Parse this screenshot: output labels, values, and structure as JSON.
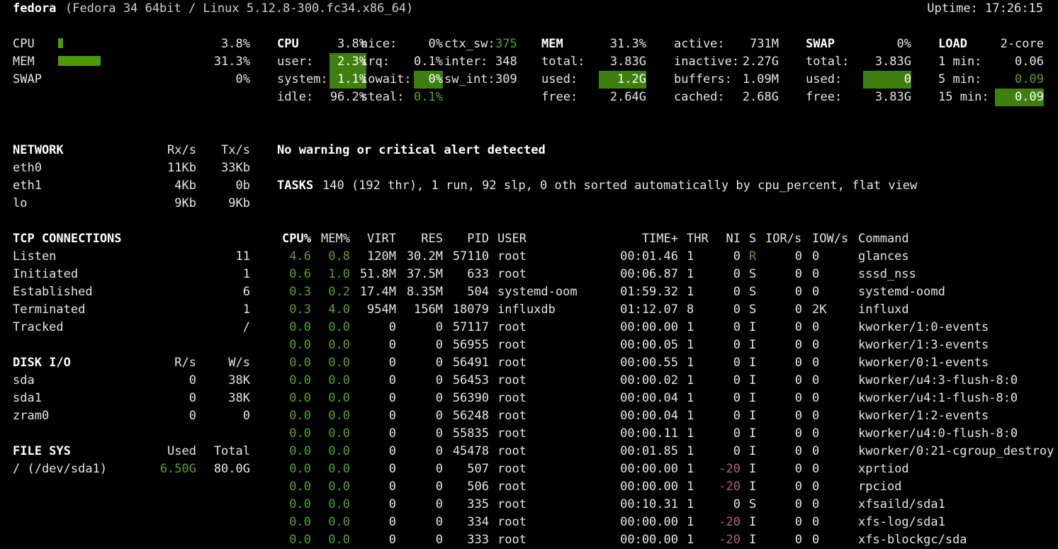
{
  "header": {
    "hostname": "fedora",
    "sysinfo": "(Fedora 34 64bit / Linux 5.12.8-300.fc34.x86_64)",
    "uptime": "Uptime: 17:26:15"
  },
  "quicklook": {
    "cpu": {
      "label": "CPU",
      "value": "3.8%",
      "pct": 3.8
    },
    "mem": {
      "label": "MEM",
      "value": "31.3%",
      "pct": 31.3
    },
    "swap": {
      "label": "SWAP",
      "value": "0%",
      "pct": 0
    }
  },
  "cpu": {
    "title": "CPU",
    "total": "3.8%",
    "user_label": "user:",
    "user": "2.3%",
    "system_label": "system:",
    "system": "1.1%",
    "idle_label": "idle:",
    "idle": "96.2%",
    "nice_label": "nice:",
    "nice": "0%",
    "irq_label": "irq:",
    "irq": "0.1%",
    "iowait_label": "iowait:",
    "iowait": "0%",
    "steal_label": "steal:",
    "steal": "0.1%",
    "ctx_sw_label": "ctx_sw:",
    "ctx_sw": "375",
    "inter_label": "inter:",
    "inter": "348",
    "sw_int_label": "sw_int:",
    "sw_int": "309"
  },
  "mem": {
    "title": "MEM",
    "pct": "31.3%",
    "total_label": "total:",
    "total": "3.83G",
    "used_label": "used:",
    "used": "1.2G",
    "free_label": "free:",
    "free": "2.64G",
    "active_label": "active:",
    "active": "731M",
    "inactive_label": "inactive:",
    "inactive": "2.27G",
    "buffers_label": "buffers:",
    "buffers": "1.09M",
    "cached_label": "cached:",
    "cached": "2.68G"
  },
  "swap": {
    "title": "SWAP",
    "pct": "0%",
    "total_label": "total:",
    "total": "3.83G",
    "used_label": "used:",
    "used": "0",
    "free_label": "free:",
    "free": "3.83G"
  },
  "load": {
    "title": "LOAD",
    "cores": "2-core",
    "min1_label": "1 min:",
    "min1": "0.06",
    "min5_label": "5 min:",
    "min5": "0.09",
    "min15_label": "15 min:",
    "min15": "0.09"
  },
  "network": {
    "title": "NETWORK",
    "rx_label": "Rx/s",
    "tx_label": "Tx/s",
    "rows": [
      {
        "name": "eth0",
        "rx": "11Kb",
        "tx": "33Kb"
      },
      {
        "name": "eth1",
        "rx": "4Kb",
        "tx": "0b"
      },
      {
        "name": "lo",
        "rx": "9Kb",
        "tx": "9Kb"
      }
    ]
  },
  "tcp": {
    "title": "TCP CONNECTIONS",
    "rows": [
      {
        "name": "Listen",
        "value": "11"
      },
      {
        "name": "Initiated",
        "value": "1"
      },
      {
        "name": "Established",
        "value": "6"
      },
      {
        "name": "Terminated",
        "value": "1"
      },
      {
        "name": "Tracked",
        "value": "/"
      }
    ]
  },
  "disk": {
    "title": "DISK I/O",
    "r_label": "R/s",
    "w_label": "W/s",
    "rows": [
      {
        "name": "sda",
        "r": "0",
        "w": "38K"
      },
      {
        "name": "sda1",
        "r": "0",
        "w": "38K"
      },
      {
        "name": "zram0",
        "r": "0",
        "w": "0"
      }
    ]
  },
  "fs": {
    "title": "FILE SYS",
    "used_label": "Used",
    "total_label": "Total",
    "rows": [
      {
        "name": "/ (/dev/sda1)",
        "used": "6.50G",
        "total": "80.0G"
      }
    ]
  },
  "alert": "No warning or critical alert detected",
  "tasks": {
    "label": "TASKS",
    "text": "140 (192 thr), 1 run, 92 slp, 0 oth sorted automatically by cpu_percent, flat view"
  },
  "proc_headers": {
    "cpu": "CPU%",
    "mem": "MEM%",
    "virt": "VIRT",
    "res": "RES",
    "pid": "PID",
    "user": "USER",
    "time": "TIME+",
    "thr": "THR",
    "ni": "NI",
    "s": "S",
    "ior": "IOR/s",
    "iow": "IOW/s",
    "cmd": "Command"
  },
  "processes": [
    {
      "cpu": "4.6",
      "mem": "0.8",
      "virt": "120M",
      "res": "30.2M",
      "pid": "57110",
      "user": "root",
      "time": "00:01.46",
      "thr": "1",
      "ni": "0",
      "s": "R",
      "ior": "0",
      "iow": "0",
      "cmd": "glances"
    },
    {
      "cpu": "0.6",
      "mem": "1.0",
      "virt": "51.8M",
      "res": "37.5M",
      "pid": "633",
      "user": "root",
      "time": "00:06.87",
      "thr": "1",
      "ni": "0",
      "s": "S",
      "ior": "0",
      "iow": "0",
      "cmd": "sssd_nss"
    },
    {
      "cpu": "0.3",
      "mem": "0.2",
      "virt": "17.4M",
      "res": "8.35M",
      "pid": "504",
      "user": "systemd-oom",
      "time": "01:59.32",
      "thr": "1",
      "ni": "0",
      "s": "S",
      "ior": "0",
      "iow": "0",
      "cmd": "systemd-oomd"
    },
    {
      "cpu": "0.3",
      "mem": "4.0",
      "virt": "954M",
      "res": "156M",
      "pid": "18079",
      "user": "influxdb",
      "time": "01:12.07",
      "thr": "8",
      "ni": "0",
      "s": "S",
      "ior": "0",
      "iow": "2K",
      "cmd": "influxd"
    },
    {
      "cpu": "0.0",
      "mem": "0.0",
      "virt": "0",
      "res": "0",
      "pid": "57117",
      "user": "root",
      "time": "00:00.00",
      "thr": "1",
      "ni": "0",
      "s": "I",
      "ior": "0",
      "iow": "0",
      "cmd": "kworker/1:0-events"
    },
    {
      "cpu": "0.0",
      "mem": "0.0",
      "virt": "0",
      "res": "0",
      "pid": "56955",
      "user": "root",
      "time": "00:00.05",
      "thr": "1",
      "ni": "0",
      "s": "I",
      "ior": "0",
      "iow": "0",
      "cmd": "kworker/1:3-events"
    },
    {
      "cpu": "0.0",
      "mem": "0.0",
      "virt": "0",
      "res": "0",
      "pid": "56491",
      "user": "root",
      "time": "00:00.55",
      "thr": "1",
      "ni": "0",
      "s": "I",
      "ior": "0",
      "iow": "0",
      "cmd": "kworker/0:1-events"
    },
    {
      "cpu": "0.0",
      "mem": "0.0",
      "virt": "0",
      "res": "0",
      "pid": "56453",
      "user": "root",
      "time": "00:00.02",
      "thr": "1",
      "ni": "0",
      "s": "I",
      "ior": "0",
      "iow": "0",
      "cmd": "kworker/u4:3-flush-8:0"
    },
    {
      "cpu": "0.0",
      "mem": "0.0",
      "virt": "0",
      "res": "0",
      "pid": "56390",
      "user": "root",
      "time": "00:00.04",
      "thr": "1",
      "ni": "0",
      "s": "I",
      "ior": "0",
      "iow": "0",
      "cmd": "kworker/u4:1-flush-8:0"
    },
    {
      "cpu": "0.0",
      "mem": "0.0",
      "virt": "0",
      "res": "0",
      "pid": "56248",
      "user": "root",
      "time": "00:00.04",
      "thr": "1",
      "ni": "0",
      "s": "I",
      "ior": "0",
      "iow": "0",
      "cmd": "kworker/1:2-events"
    },
    {
      "cpu": "0.0",
      "mem": "0.0",
      "virt": "0",
      "res": "0",
      "pid": "55835",
      "user": "root",
      "time": "00:00.11",
      "thr": "1",
      "ni": "0",
      "s": "I",
      "ior": "0",
      "iow": "0",
      "cmd": "kworker/u4:0-flush-8:0"
    },
    {
      "cpu": "0.0",
      "mem": "0.0",
      "virt": "0",
      "res": "0",
      "pid": "45478",
      "user": "root",
      "time": "00:01.85",
      "thr": "1",
      "ni": "0",
      "s": "I",
      "ior": "0",
      "iow": "0",
      "cmd": "kworker/0:21-cgroup_destroy"
    },
    {
      "cpu": "0.0",
      "mem": "0.0",
      "virt": "0",
      "res": "0",
      "pid": "507",
      "user": "root",
      "time": "00:00.00",
      "thr": "1",
      "ni": "-20",
      "s": "I",
      "ior": "0",
      "iow": "0",
      "cmd": "xprtiod"
    },
    {
      "cpu": "0.0",
      "mem": "0.0",
      "virt": "0",
      "res": "0",
      "pid": "506",
      "user": "root",
      "time": "00:00.00",
      "thr": "1",
      "ni": "-20",
      "s": "I",
      "ior": "0",
      "iow": "0",
      "cmd": "rpciod"
    },
    {
      "cpu": "0.0",
      "mem": "0.0",
      "virt": "0",
      "res": "0",
      "pid": "335",
      "user": "root",
      "time": "00:10.31",
      "thr": "1",
      "ni": "0",
      "s": "S",
      "ior": "0",
      "iow": "0",
      "cmd": "xfsaild/sda1"
    },
    {
      "cpu": "0.0",
      "mem": "0.0",
      "virt": "0",
      "res": "0",
      "pid": "334",
      "user": "root",
      "time": "00:00.00",
      "thr": "1",
      "ni": "-20",
      "s": "I",
      "ior": "0",
      "iow": "0",
      "cmd": "xfs-log/sda1"
    },
    {
      "cpu": "0.0",
      "mem": "0.0",
      "virt": "0",
      "res": "0",
      "pid": "333",
      "user": "root",
      "time": "00:00.00",
      "thr": "1",
      "ni": "-20",
      "s": "I",
      "ior": "0",
      "iow": "0",
      "cmd": "xfs-blockgc/sda"
    }
  ]
}
